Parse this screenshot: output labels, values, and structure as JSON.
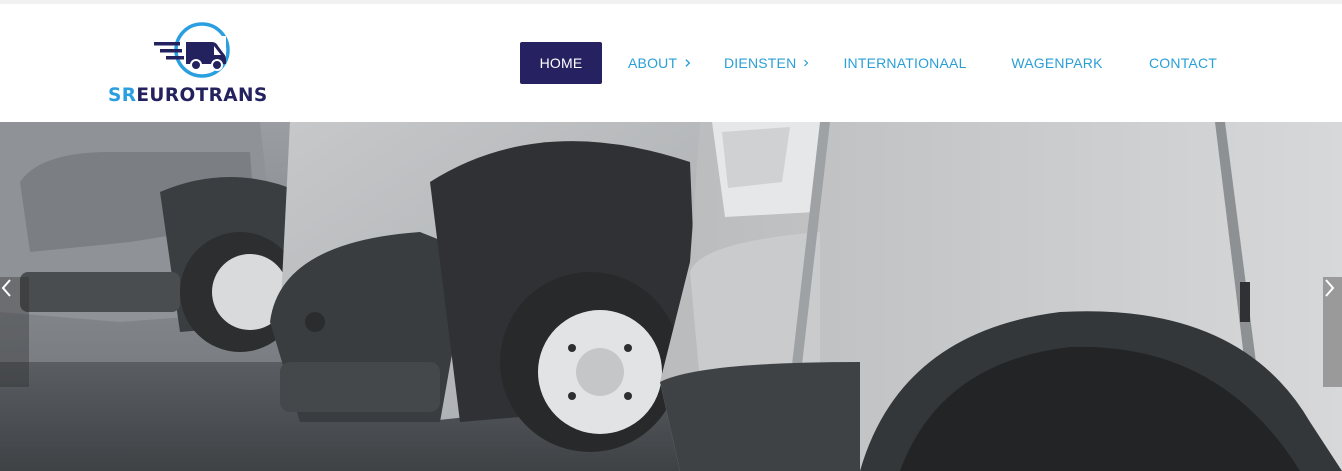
{
  "brand": {
    "prefix": "SR",
    "suffix": "EUROTRANS",
    "colors": {
      "prefix": "#2a9fe0",
      "suffix": "#24215f"
    },
    "icon": "van-speed-logo"
  },
  "nav": {
    "items": [
      {
        "label": "HOME",
        "active": true,
        "has_submenu": false
      },
      {
        "label": "ABOUT",
        "active": false,
        "has_submenu": true
      },
      {
        "label": "DIENSTEN",
        "active": false,
        "has_submenu": true
      },
      {
        "label": "INTERNATIONAAL",
        "active": false,
        "has_submenu": false
      },
      {
        "label": "WAGENPARK",
        "active": false,
        "has_submenu": false
      },
      {
        "label": "CONTACT",
        "active": false,
        "has_submenu": false
      }
    ],
    "colors": {
      "text": "#2a9fd6",
      "active_bg": "#262262",
      "active_text": "#ffffff"
    }
  },
  "hero": {
    "image": "white-vans-row-photo",
    "prev_icon": "chevron-left-icon",
    "next_icon": "chevron-right-icon"
  }
}
